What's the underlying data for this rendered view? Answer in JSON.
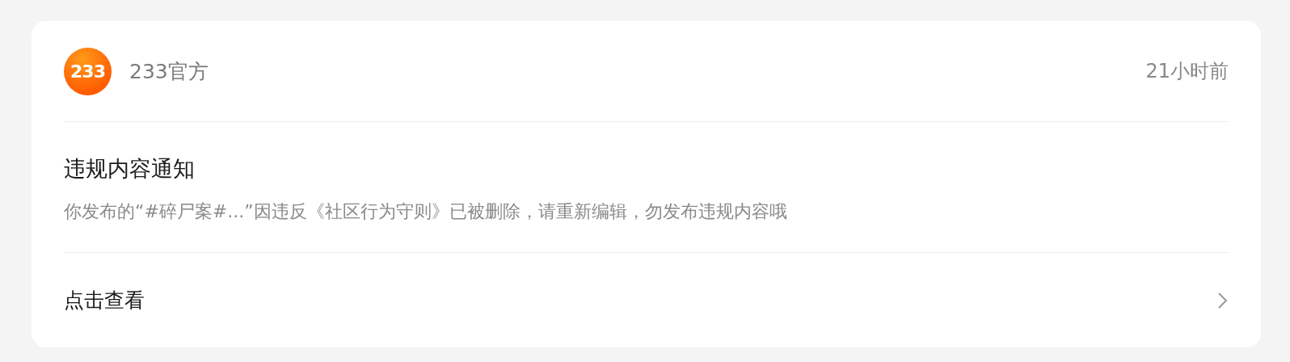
{
  "header": {
    "logo_text": "233",
    "sender": "233官方",
    "time": "21小时前"
  },
  "notice": {
    "title": "违规内容通知",
    "body": "你发布的“#碎尸案#...”因违反《社区行为守则》已被删除，请重新编辑，勿发布违规内容哦"
  },
  "footer": {
    "link": "点击查看"
  }
}
